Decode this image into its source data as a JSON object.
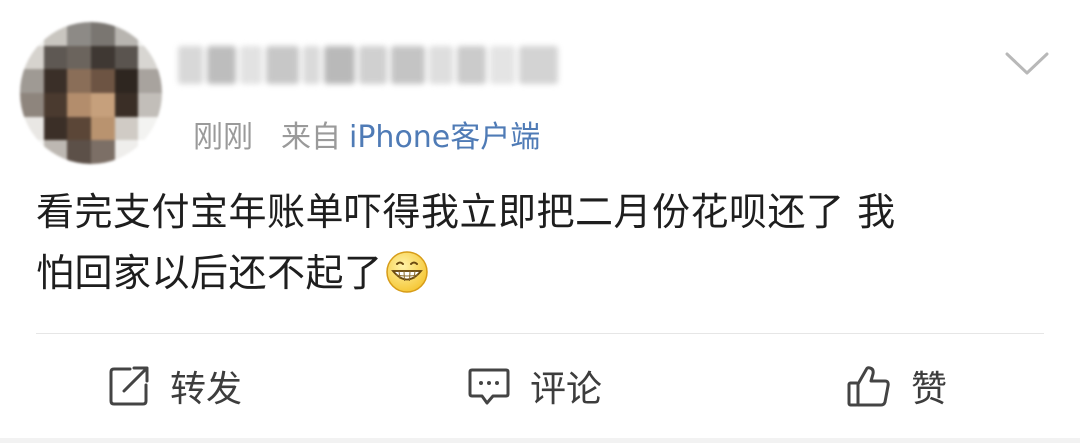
{
  "post": {
    "time": "刚刚",
    "source_prefix": "来自",
    "source_client": "iPhone客户端",
    "text_line1": "看完支付宝年账单吓得我立即把二月份花呗还了 我",
    "text_line2": "怕回家以后还不起了",
    "emoji": "grinning-face-icon"
  },
  "actions": {
    "repost_label": "转发",
    "comment_label": "评论",
    "like_label": "赞"
  },
  "colors": {
    "link": "#4f7bb6",
    "meta": "#9a9a9a",
    "text": "#1e1e1e",
    "divider": "#e6e6e6"
  }
}
